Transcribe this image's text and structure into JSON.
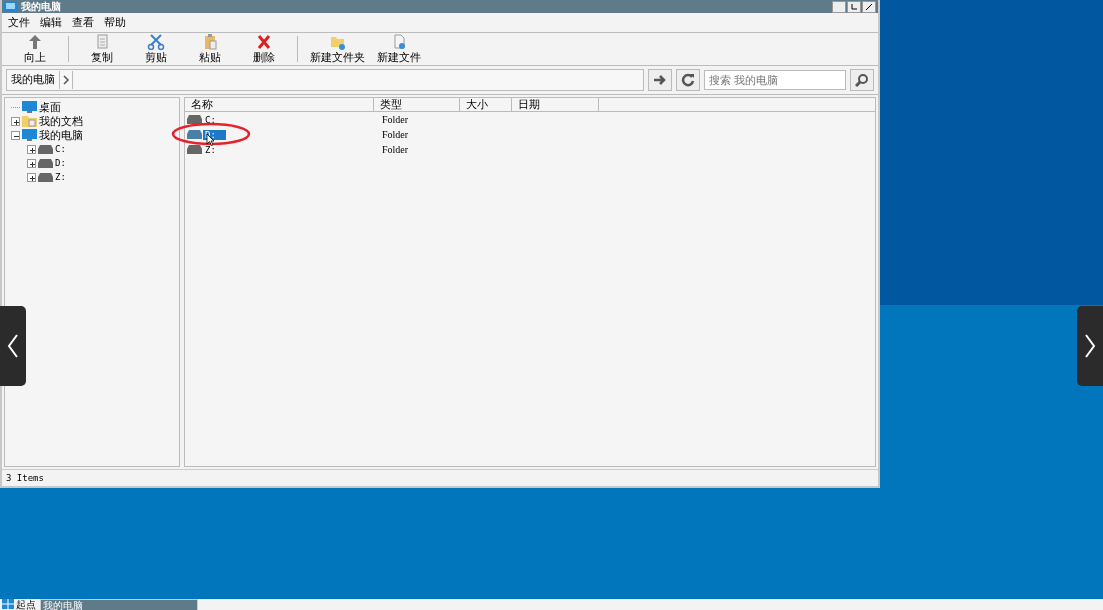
{
  "window": {
    "title": "我的电脑"
  },
  "menu": [
    "文件",
    "编辑",
    "查看",
    "帮助"
  ],
  "toolbar": [
    [
      {
        "kind": "up",
        "label": "向上"
      }
    ],
    [
      {
        "kind": "copy",
        "label": "复制"
      },
      {
        "kind": "cut",
        "label": "剪贴"
      },
      {
        "kind": "paste",
        "label": "粘贴"
      },
      {
        "kind": "delete",
        "label": "删除"
      }
    ],
    [
      {
        "kind": "new-folder",
        "label": "新建文件夹"
      },
      {
        "kind": "new-file",
        "label": "新建文件"
      }
    ]
  ],
  "address": {
    "crumb": "我的电脑",
    "search_placeholder": "搜索 我的电脑"
  },
  "tree": [
    {
      "label": "桌面",
      "kind": "desktop"
    },
    {
      "label": "我的文档",
      "kind": "documents",
      "expanded": false
    },
    {
      "label": "我的电脑",
      "kind": "computer",
      "expanded": true,
      "children": [
        {
          "label": "C:",
          "kind": "drive",
          "expanded": false
        },
        {
          "label": "D:",
          "kind": "drive",
          "expanded": false
        },
        {
          "label": "Z:",
          "kind": "drive",
          "expanded": false
        }
      ]
    }
  ],
  "table": {
    "columns": [
      "名称",
      "类型",
      "大小",
      "日期"
    ],
    "rows": [
      {
        "name": "C:",
        "type": "Folder",
        "selected": false
      },
      {
        "name": "D:",
        "type": "Folder",
        "selected": true
      },
      {
        "name": "Z:",
        "type": "Folder",
        "selected": false
      }
    ]
  },
  "status_bar": "3 Items",
  "taskbar": {
    "start": "起点",
    "items": [
      {
        "label": "我的电脑",
        "selected": true
      }
    ]
  }
}
